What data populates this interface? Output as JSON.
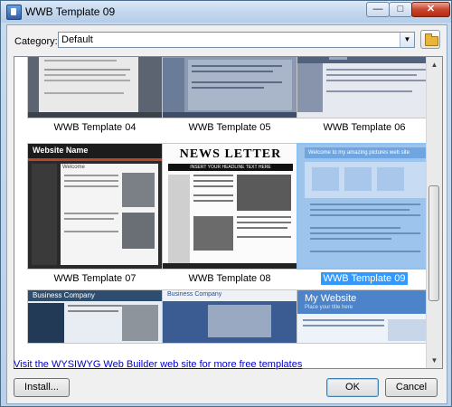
{
  "window": {
    "title": "WWB Template 09"
  },
  "toolbar": {
    "category_label": "Category:",
    "category_value": "Default"
  },
  "templates": [
    {
      "name": "WWB Template 04",
      "selected": false
    },
    {
      "name": "WWB Template 05",
      "selected": false
    },
    {
      "name": "WWB Template 06",
      "selected": false
    },
    {
      "name": "WWB Template 07",
      "selected": false
    },
    {
      "name": "WWB Template 08",
      "selected": false
    },
    {
      "name": "WWB Template 09",
      "selected": true
    }
  ],
  "thumbnail_text": {
    "t07_header": "Website Name",
    "t07_tab": "Welcome",
    "t08_header": "NEWS LETTER",
    "t08_headline": "INSERT YOUR HEADLINE TEXT HERE",
    "t09_banner": "Welcome to my amazing pictures web site",
    "t10_header": "Business Company",
    "t11_header": "Business Company",
    "t12_header": "My Website",
    "t12_sub": "Place your title here"
  },
  "footer": {
    "link_text": "Visit the WYSIWYG Web Builder web site for more free templates",
    "install_label": "Install...",
    "ok_label": "OK",
    "cancel_label": "Cancel"
  },
  "colors": {
    "selection": "#3399ff",
    "link": "#0000cc",
    "close_button": "#c8462c"
  },
  "icons": {
    "app": "wwb-app-icon",
    "folder": "folder-icon",
    "minimize": "minimize-icon",
    "maximize": "maximize-icon",
    "close": "close-icon"
  }
}
